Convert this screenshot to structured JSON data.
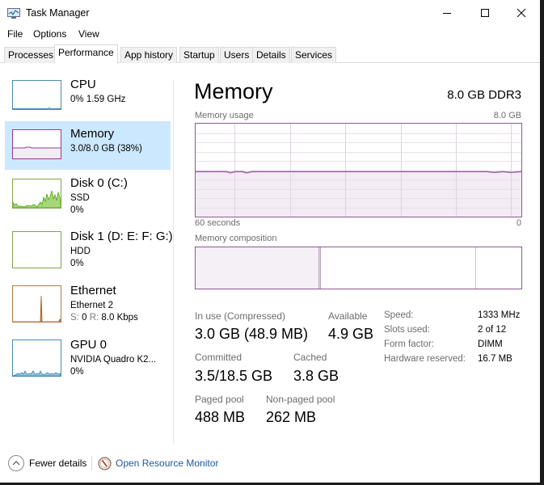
{
  "window": {
    "title": "Task Manager",
    "controls": [
      "minimize",
      "maximize",
      "close"
    ]
  },
  "menu": [
    "File",
    "Options",
    "View"
  ],
  "tabs": [
    {
      "label": "Processes",
      "active": false
    },
    {
      "label": "Performance",
      "active": true
    },
    {
      "label": "App history",
      "active": false
    },
    {
      "label": "Startup",
      "active": false
    },
    {
      "label": "Users",
      "active": false
    },
    {
      "label": "Details",
      "active": false
    },
    {
      "label": "Services",
      "active": false
    }
  ],
  "sidebar": {
    "items": [
      {
        "title": "CPU",
        "line1": "0% 1.59 GHz",
        "line2": "",
        "color": "#4a8bad",
        "selected": false
      },
      {
        "title": "Memory",
        "line1": "3.0/8.0 GB (38%)",
        "line2": "",
        "color": "#8b3f96",
        "selected": true
      },
      {
        "title": "Disk 0 (C:)",
        "line1": "SSD",
        "line2": "0%",
        "color": "#4da60c",
        "selected": false
      },
      {
        "title": "Disk 1 (D: E: F: G:)",
        "line1": "HDD",
        "line2": "0%",
        "color": "#4da60c",
        "selected": false
      },
      {
        "title": "Ethernet",
        "line1": "Ethernet 2",
        "line2_send_label": "S:",
        "line2_send": "0",
        "line2_recv_label": "R:",
        "line2_recv": "8.0 Kbps",
        "color": "#a74f01",
        "selected": false
      },
      {
        "title": "GPU 0",
        "line1": "NVIDIA Quadro K2...",
        "line2": "0%",
        "color": "#4a8bad",
        "selected": false
      }
    ]
  },
  "main": {
    "title": "Memory",
    "spec": "8.0 GB DDR3",
    "usage_label": "Memory usage",
    "usage_max": "8.0 GB",
    "time_left": "60 seconds",
    "time_right": "0",
    "composition_label": "Memory composition",
    "composition": {
      "in_use_fraction": 0.38,
      "modified_fraction": 0.005,
      "standby_fraction": 0.475,
      "free_fraction": 0.14
    },
    "usage_percent": 38,
    "stats": {
      "in_use_label": "In use (Compressed)",
      "in_use_value": "3.0 GB (48.9 MB)",
      "available_label": "Available",
      "available_value": "4.9 GB",
      "committed_label": "Committed",
      "committed_value": "3.5/18.5 GB",
      "cached_label": "Cached",
      "cached_value": "3.8 GB",
      "paged_label": "Paged pool",
      "paged_value": "488 MB",
      "nonpaged_label": "Non-paged pool",
      "nonpaged_value": "262 MB"
    },
    "details": [
      {
        "label": "Speed:",
        "value": "1333 MHz"
      },
      {
        "label": "Slots used:",
        "value": "2 of 12"
      },
      {
        "label": "Form factor:",
        "value": "DIMM"
      },
      {
        "label": "Hardware reserved:",
        "value": "16.7 MB"
      }
    ]
  },
  "footer": {
    "fewer_details": "Fewer details",
    "open_resource_monitor": "Open Resource Monitor"
  },
  "colors": {
    "memory_accent": "#8b3f96",
    "selected_bg": "#cce8ff",
    "link": "#1d5a9e"
  }
}
